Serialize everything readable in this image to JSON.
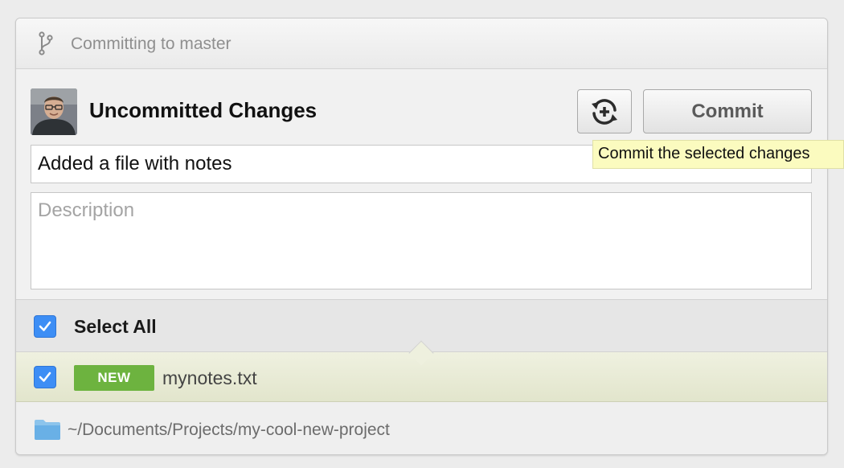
{
  "header": {
    "icon": "git-branch-icon",
    "text": "Committing to master"
  },
  "commit_form": {
    "avatar": "user-avatar",
    "title": "Uncommitted Changes",
    "sync_icon": "sync-add-icon",
    "commit_label": "Commit",
    "summary_value": "Added a file with notes",
    "description_placeholder": "Description"
  },
  "tooltip": {
    "text": "Commit the selected changes"
  },
  "changes": {
    "select_all_label": "Select All",
    "select_all_checked": true,
    "files": [
      {
        "badge": "NEW",
        "name": "mynotes.txt",
        "checked": true
      }
    ]
  },
  "footer": {
    "icon": "folder-icon",
    "path": "~/Documents/Projects/my-cool-new-project"
  },
  "colors": {
    "checkbox": "#3d8ef5",
    "new_badge": "#6db33f",
    "tooltip_bg": "#fbfbbf",
    "selected_row": "#e8ebd5"
  }
}
